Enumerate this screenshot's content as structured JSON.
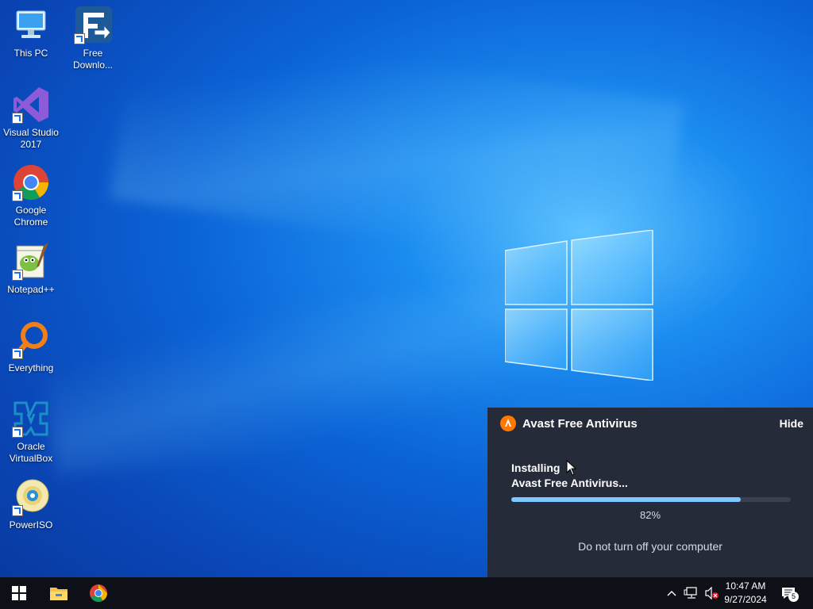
{
  "desktop": {
    "icons": [
      {
        "label": "This PC",
        "icon": "computer-icon"
      },
      {
        "label": "Free\nDownlo...",
        "icon": "free-download-manager-icon"
      },
      {
        "label": "Visual Studio\n2017",
        "icon": "visual-studio-icon"
      },
      {
        "label": "Google\nChrome",
        "icon": "chrome-icon"
      },
      {
        "label": "Notepad++",
        "icon": "notepadpp-icon"
      },
      {
        "label": "Everything",
        "icon": "everything-search-icon"
      },
      {
        "label": "Oracle\nVirtualBox",
        "icon": "virtualbox-icon"
      },
      {
        "label": "PowerISO",
        "icon": "poweriso-disc-icon"
      }
    ]
  },
  "avast": {
    "title": "Avast Free Antivirus",
    "hide_label": "Hide",
    "status_line1": "Installing",
    "status_line2": "Avast Free Antivirus...",
    "progress_label": "82%",
    "progress_fraction": 0.82,
    "note": "Do not turn off your computer",
    "accent": "#ff7800"
  },
  "taskbar": {
    "start_icon": "windows-start-icon",
    "pinned": [
      "file-explorer-icon",
      "chrome-icon"
    ],
    "tray_icons": [
      "chevron-up-icon",
      "network-icon",
      "volume-muted-icon"
    ],
    "time": "10:47 AM",
    "date": "9/27/2024",
    "notification_count": "5"
  }
}
